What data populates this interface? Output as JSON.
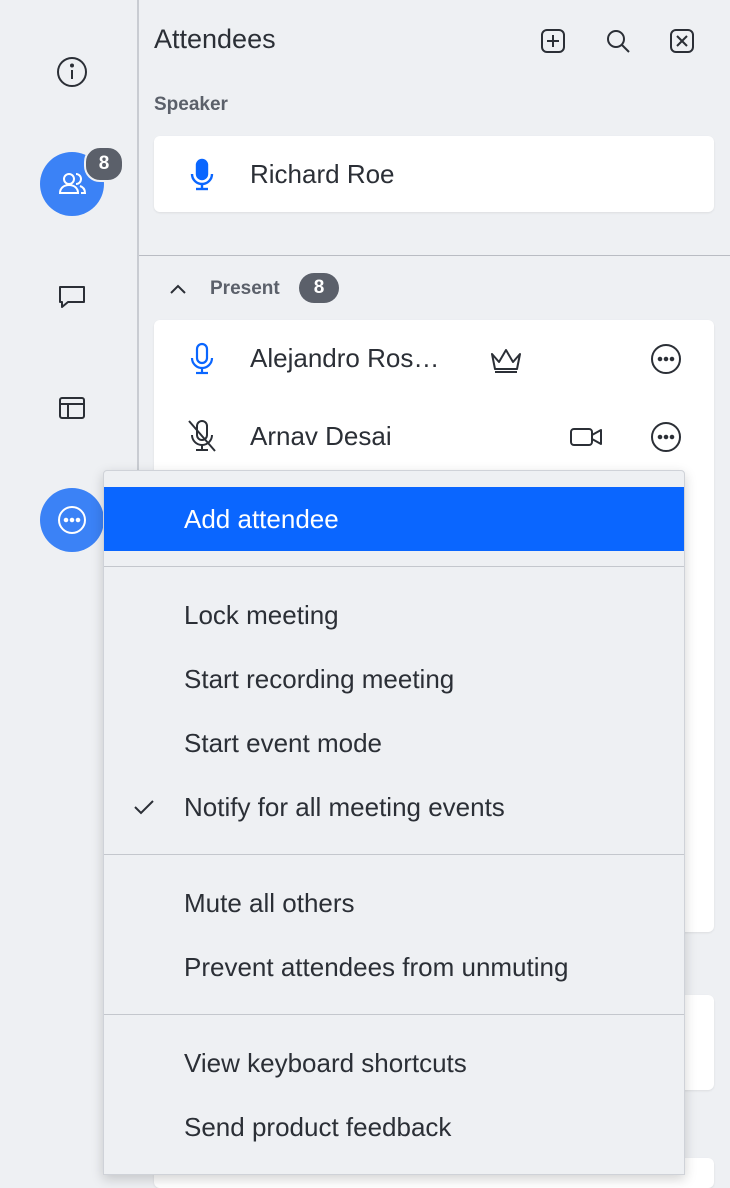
{
  "rail": {
    "attendees_badge": "8",
    "icons": [
      "info-icon",
      "attendees-icon",
      "chat-icon",
      "layout-icon",
      "more-icon"
    ],
    "accent": "#3b82f6"
  },
  "panel": {
    "title": "Attendees",
    "header_icons": [
      "add-icon",
      "search-icon",
      "close-icon"
    ],
    "speaker_label": "Speaker",
    "speaker_name": "Richard Roe",
    "present_label": "Present",
    "present_count": "8",
    "attendees": [
      {
        "name": "Alejandro Ros…",
        "icon": "crown-icon"
      },
      {
        "name": "Arnav Desai",
        "icon": "video-icon"
      }
    ]
  },
  "menu": {
    "highlight_color": "#0a66ff",
    "groups": [
      [
        {
          "label": "Add attendee",
          "highlighted": true
        }
      ],
      [
        {
          "label": "Lock meeting"
        },
        {
          "label": "Start recording meeting"
        },
        {
          "label": "Start event mode"
        },
        {
          "label": "Notify for all meeting events",
          "checked": true
        }
      ],
      [
        {
          "label": "Mute all others"
        },
        {
          "label": "Prevent attendees from unmuting"
        }
      ],
      [
        {
          "label": "View keyboard shortcuts"
        },
        {
          "label": "Send product feedback"
        }
      ]
    ]
  }
}
